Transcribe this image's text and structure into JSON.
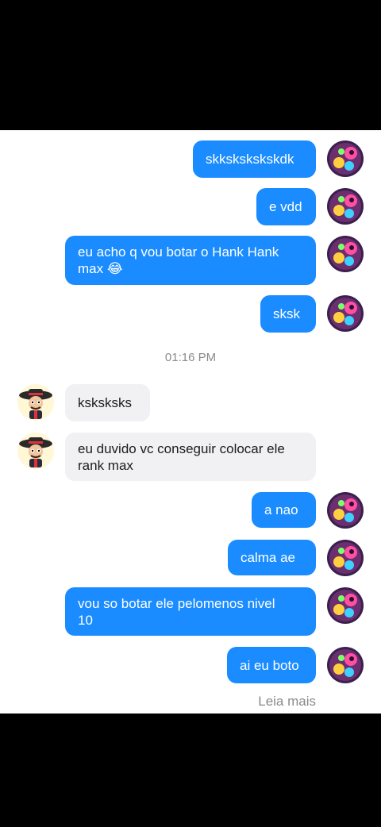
{
  "colors": {
    "outgoing_bubble": "#1a8cff",
    "incoming_bubble": "#f1f0f3",
    "timestamp_text": "#8a8a8a"
  },
  "messages": [
    {
      "direction": "out",
      "text": "skkskskskskdk"
    },
    {
      "direction": "out",
      "text": "e vdd"
    },
    {
      "direction": "out",
      "text": "eu acho q vou botar o Hank Hank\nmax 😂"
    },
    {
      "direction": "out",
      "text": "sksk"
    },
    {
      "direction": "in",
      "text": "ksksksks"
    },
    {
      "direction": "in",
      "text": "eu duvido vc conseguir colocar ele\nrank max"
    },
    {
      "direction": "out",
      "text": "a nao"
    },
    {
      "direction": "out",
      "text": "calma ae"
    },
    {
      "direction": "out",
      "text": "vou so botar ele pelomenos nivel\n10"
    },
    {
      "direction": "out",
      "text": "ai eu boto"
    }
  ],
  "timestamp": "01:16 PM",
  "read_more": "Leia mais",
  "icons": {
    "outgoing_avatar": "user-avatar-icon",
    "incoming_avatar": "contact-avatar-icon"
  }
}
